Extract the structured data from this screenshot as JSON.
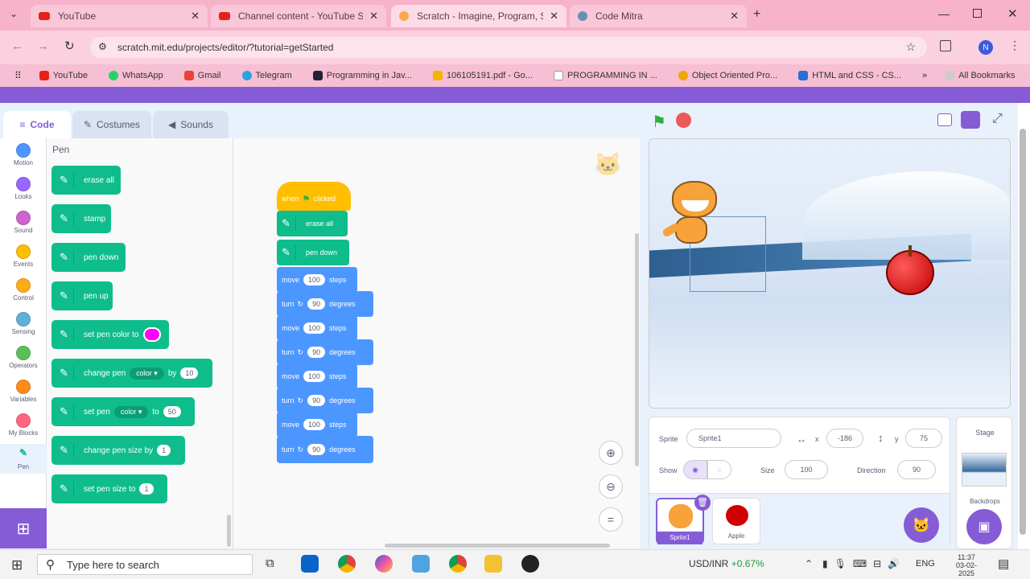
{
  "browser": {
    "tabs": [
      {
        "title": "YouTube"
      },
      {
        "title": "Channel content - YouTube St..."
      },
      {
        "title": "Scratch - Imagine, Program, Sh..."
      },
      {
        "title": "Code Mitra"
      }
    ],
    "url": "scratch.mit.edu/projects/editor/?tutorial=getStarted",
    "profile_initial": "N",
    "bookmarks": [
      "YouTube",
      "WhatsApp",
      "Gmail",
      "Telegram",
      "Programming in Jav...",
      "106105191.pdf - Go...",
      "PROGRAMMING IN ...",
      "Object Oriented Pro...",
      "HTML and CSS - CS...",
      "All Bookmarks"
    ]
  },
  "editor": {
    "tabs": {
      "code": "Code",
      "costumes": "Costumes",
      "sounds": "Sounds"
    },
    "categories": [
      {
        "label": "Motion",
        "color": "#4c97ff"
      },
      {
        "label": "Looks",
        "color": "#9966ff"
      },
      {
        "label": "Sound",
        "color": "#cf63cf"
      },
      {
        "label": "Events",
        "color": "#ffbf00"
      },
      {
        "label": "Control",
        "color": "#ffab19"
      },
      {
        "label": "Sensing",
        "color": "#5cb1d6"
      },
      {
        "label": "Operators",
        "color": "#59c059"
      },
      {
        "label": "Variables",
        "color": "#ff8c1a"
      },
      {
        "label": "My Blocks",
        "color": "#ff6680"
      },
      {
        "label": "Pen",
        "color": "#0fbd8c"
      }
    ],
    "palette_title": "Pen",
    "palette": {
      "erase_all": "erase all",
      "stamp": "stamp",
      "pen_down": "pen down",
      "pen_up": "pen up",
      "set_pen_color": "set pen color to",
      "pen_color_value": "#ff00ff",
      "change_pen": "change pen",
      "change_pen_dd": "color",
      "change_by": "by",
      "change_value": "10",
      "set_pen": "set pen",
      "set_pen_dd": "color",
      "set_to": "to",
      "set_value": "50",
      "change_size": "change pen size by",
      "change_size_value": "1",
      "set_size": "set pen size to",
      "set_size_value": "1"
    },
    "script": {
      "hat_when": "when",
      "hat_clicked": "clicked",
      "erase_all": "erase all",
      "pen_down": "pen down",
      "move": "move",
      "steps": "steps",
      "turn": "turn",
      "degrees": "degrees",
      "steps_value": "100",
      "degrees_value": "90"
    },
    "zoom_reset": "="
  },
  "sprite_info": {
    "sprite_label": "Sprite",
    "sprite_name": "Sprite1",
    "x_label": "x",
    "x_value": "-186",
    "y_label": "y",
    "y_value": "75",
    "show_label": "Show",
    "size_label": "Size",
    "size_value": "100",
    "direction_label": "Direction",
    "direction_value": "90",
    "sprites": [
      {
        "name": "Sprite1"
      },
      {
        "name": "Apple"
      }
    ]
  },
  "stage_panel": {
    "title": "Stage",
    "backdrops_label": "Backdrops"
  },
  "taskbar": {
    "search_placeholder": "Type here to search",
    "ticker": "USD/INR",
    "ticker_change": "+0.67%",
    "lang": "ENG",
    "time": "11:37",
    "date": "03-02-2025"
  }
}
